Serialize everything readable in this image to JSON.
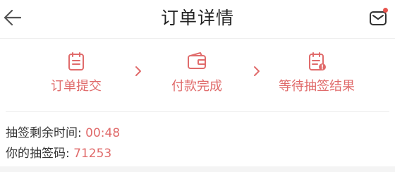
{
  "header": {
    "title": "订单详情",
    "back_icon": "back-arrow-icon",
    "message_icon": "message-envelope-icon",
    "has_unread_dot": true
  },
  "steps": [
    {
      "label": "订单提交",
      "icon": "clipboard-icon"
    },
    {
      "label": "付款完成",
      "icon": "wallet-icon"
    },
    {
      "label": "等待抽签结果",
      "icon": "clipboard-alert-icon"
    }
  ],
  "info": {
    "countdown_label": "抽签剩余时间: ",
    "countdown_value": "00:48",
    "code_label": "你的抽签码: ",
    "code_value": "71253"
  },
  "colors": {
    "accent": "#e06b6b",
    "text": "#333333",
    "notify_dot": "#e8554e"
  }
}
